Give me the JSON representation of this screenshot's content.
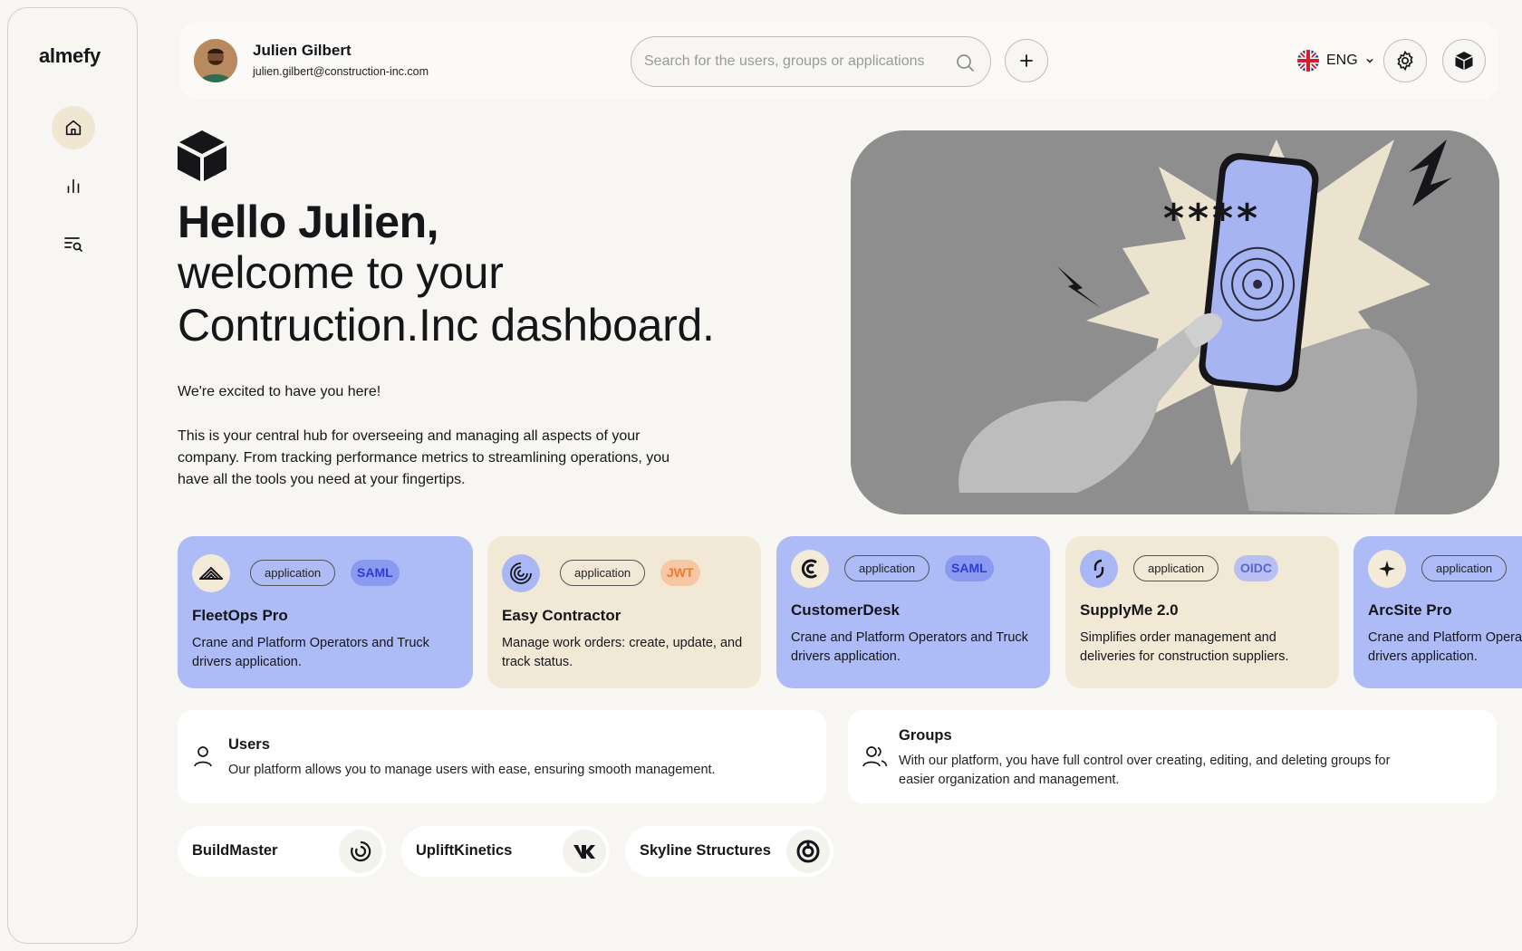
{
  "sidebar": {
    "logo": "almefy",
    "items": [
      {
        "name": "home",
        "icon": "home-icon",
        "active": true
      },
      {
        "name": "analytics",
        "icon": "bar-chart-icon",
        "active": false
      },
      {
        "name": "search-list",
        "icon": "list-search-icon",
        "active": false
      }
    ]
  },
  "header": {
    "user_name": "Julien Gilbert",
    "user_email": "julien.gilbert@construction-inc.com",
    "search_placeholder": "Search for the users, groups or applications",
    "language": "ENG"
  },
  "hero": {
    "greeting": "Hello Julien,",
    "welcome_line1": "welcome to your",
    "welcome_line2": "Contruction.Inc dashboard.",
    "excited": "We're excited to have you here!",
    "description": "This is your central hub for overseeing and managing all aspects of your company. From tracking performance metrics to streamlining operations, you have all the tools you need at your fingertips.",
    "image_text": "****"
  },
  "apps": [
    {
      "title": "FleetOps Pro",
      "tag": "application",
      "protocol": "SAML",
      "description": "Crane and Platform Operators and Truck drivers application."
    },
    {
      "title": "Easy Contractor",
      "tag": "application",
      "protocol": "JWT",
      "description": "Manage work orders: create, update, and track status."
    },
    {
      "title": "CustomerDesk",
      "tag": "application",
      "protocol": "SAML",
      "description": "Crane and Platform Operators and Truck drivers application."
    },
    {
      "title": "SupplyMe 2.0",
      "tag": "application",
      "protocol": "OIDC",
      "description": "Simplifies order management and deliveries for construction suppliers."
    },
    {
      "title": "ArcSite Pro",
      "tag": "application",
      "protocol": "",
      "description": "Crane and Platform Operators and Truck drivers application."
    }
  ],
  "users_card": {
    "title": "Users",
    "description": "Our platform allows you to manage users with ease, ensuring smooth management."
  },
  "groups_card": {
    "title": "Groups",
    "description": "With our platform, you have full control over creating, editing, and deleting groups for easier organization and management."
  },
  "brands": [
    {
      "name": "BuildMaster",
      "icon": "spiral-logo-icon"
    },
    {
      "name": "UpliftKinetics",
      "icon": "vk-logo-icon"
    },
    {
      "name": "Skyline Structures",
      "icon": "power-ring-logo-icon"
    }
  ],
  "colors": {
    "background": "#f7f6f2",
    "card_blue": "#adbbf7",
    "card_beige": "#f2e8d6",
    "saml": "#2b3cd8",
    "jwt": "#ee7a3a",
    "oidc": "#5b66cf"
  }
}
